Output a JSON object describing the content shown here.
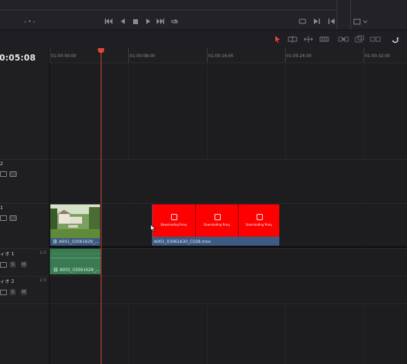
{
  "transport": {
    "jog_indicator": "‹ • ›",
    "buttons": [
      "skip-to-start",
      "play-reverse",
      "stop",
      "play",
      "skip-to-end",
      "loop"
    ]
  },
  "header": {
    "timecode": "0:05:08",
    "tracks": [
      {
        "id": "v2",
        "name": "2"
      },
      {
        "id": "v1",
        "name": "1"
      },
      {
        "id": "a1",
        "name": "ィオ 1",
        "volume": "2.0",
        "solo": "S",
        "mute": "M"
      },
      {
        "id": "a2",
        "name": "ィオ 2",
        "volume": "2.0",
        "solo": "S",
        "mute": "M"
      }
    ]
  },
  "ruler": {
    "labels": [
      "01:00:00:00",
      "01:00:08:00",
      "01:00:16:00",
      "01:00:24:00",
      "01:00:32:00"
    ]
  },
  "clips": {
    "video1_label": "A001_03061629_...",
    "video2_label": "A001_03061630_C028.mov",
    "proxy_text": "Downloading Proxy",
    "audio1_label": "A001_03061629_..."
  },
  "colors": {
    "playhead": "#e0443a",
    "proxy_red": "#ff0000",
    "clip_blue": "#3d5a82",
    "audio_green": "#3a7a52",
    "tool_active": "#e0443a"
  },
  "icons": {
    "link": "link-icon",
    "selection": "pointer-icon",
    "snapping": "magnet-icon"
  }
}
